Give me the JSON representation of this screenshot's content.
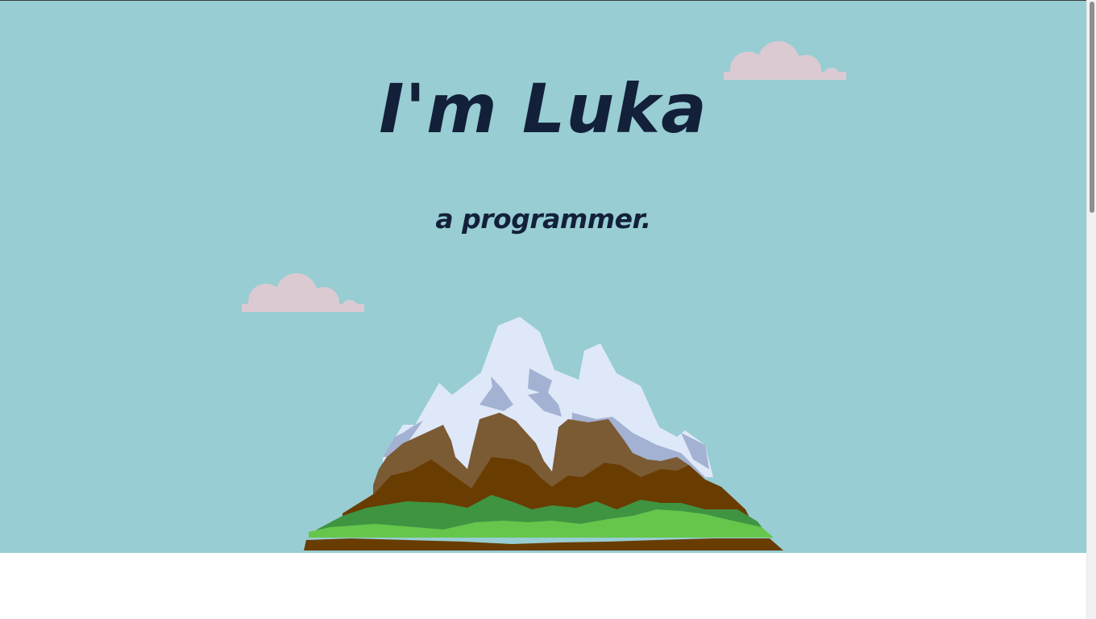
{
  "hero": {
    "title": "I'm Luka",
    "subtitle": "a programmer."
  },
  "colors": {
    "sky": "#97cdd3",
    "text": "#13203a",
    "cloud": "#dccad2",
    "snow": "#dfe8f8",
    "snow_shadow": "#a3b1d2",
    "rock_light": "#7b5b34",
    "rock_dark": "#693c02",
    "grass_dark": "#3f9442",
    "grass_light": "#66c64c",
    "below_background": "#ffffff"
  },
  "icons": [
    "cloud-icon",
    "cloud-icon",
    "mountain-illustration"
  ]
}
